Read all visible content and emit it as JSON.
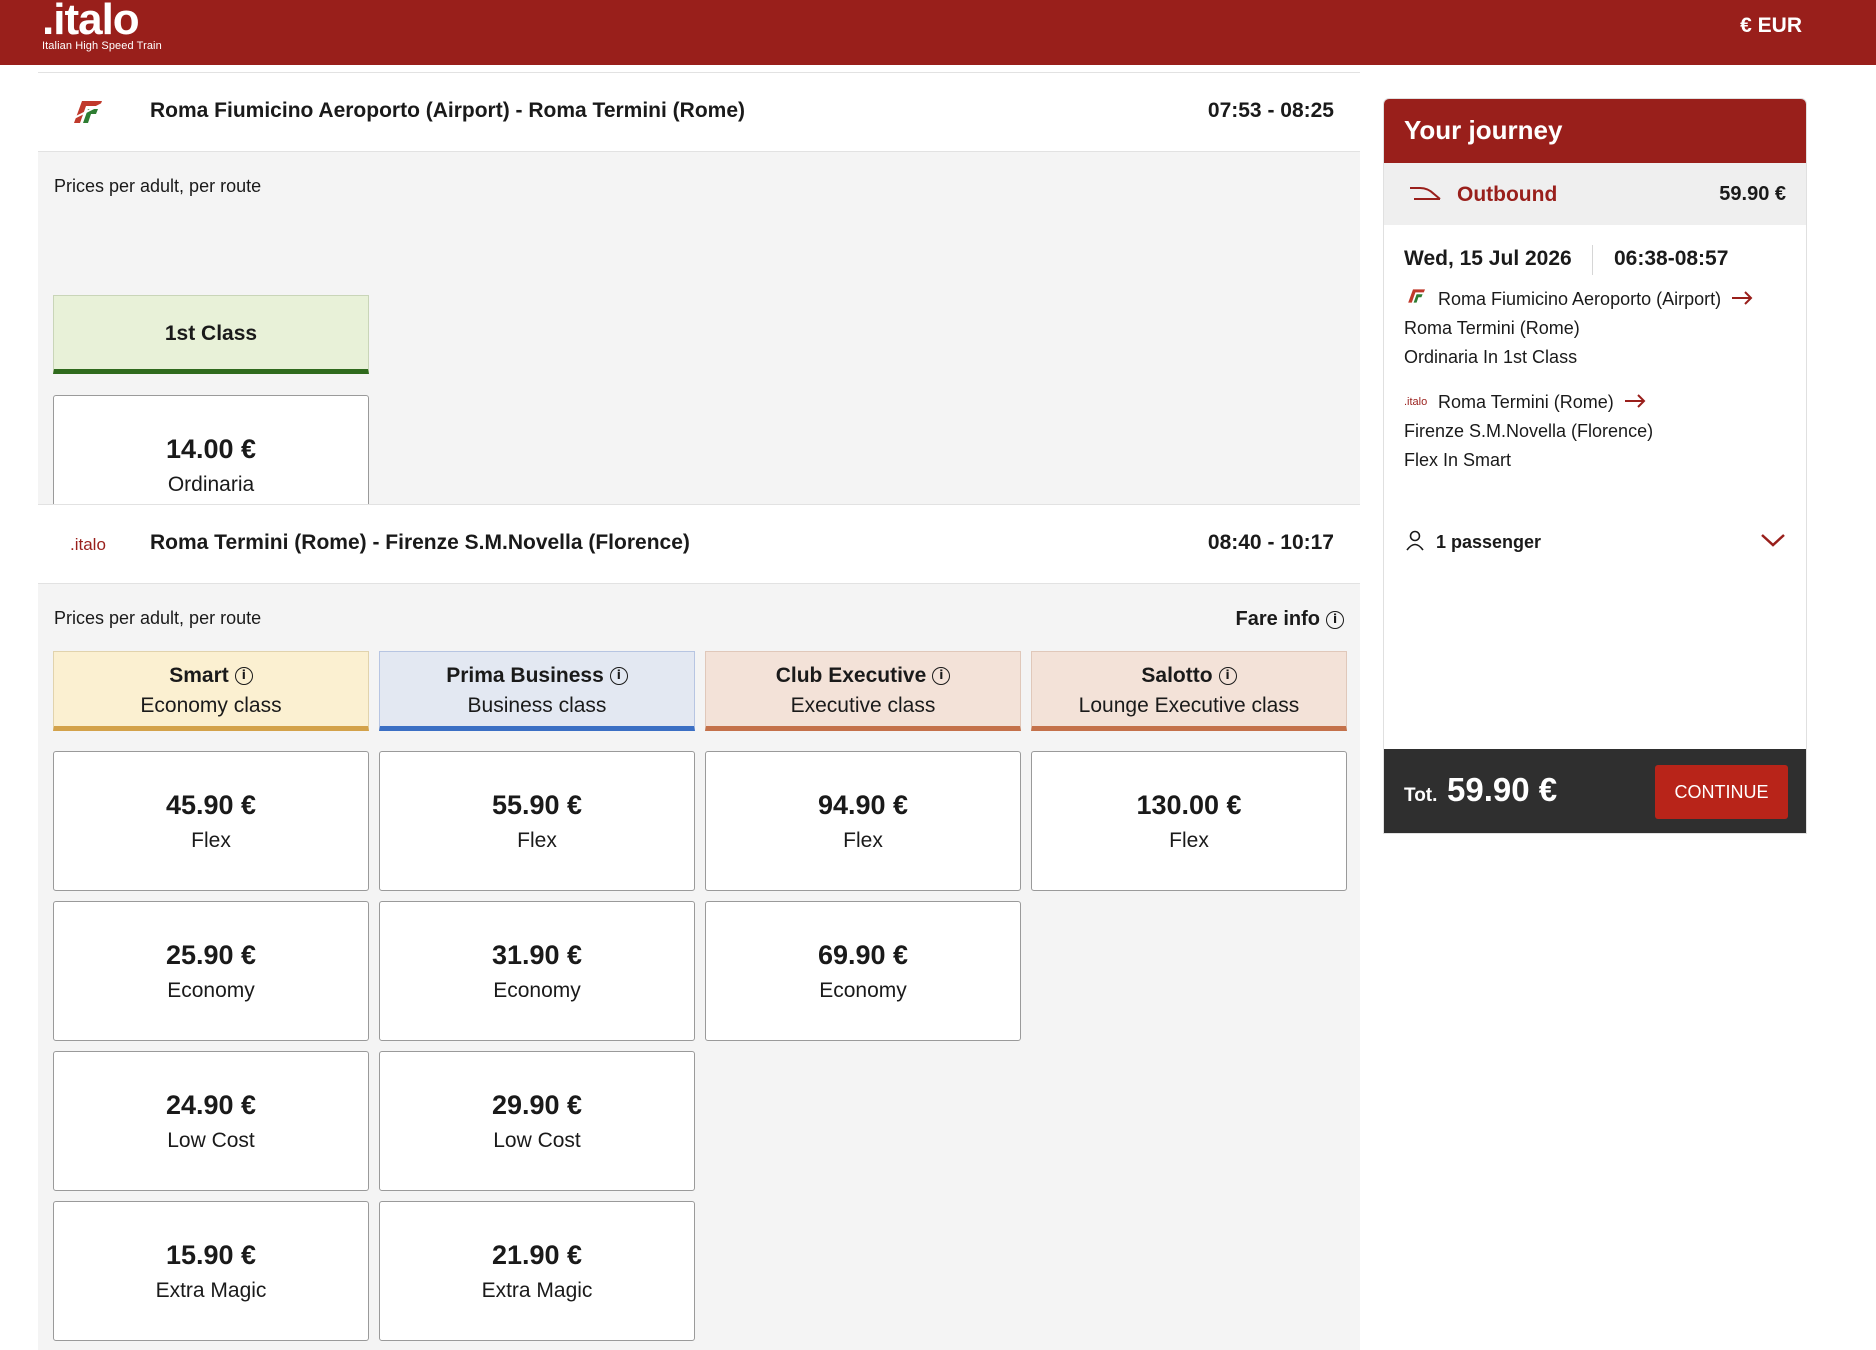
{
  "header": {
    "logo_word": ".italo",
    "logo_tagline": "Italian High Speed Train",
    "currency": "€ EUR"
  },
  "routes": [
    {
      "name": "Roma Fiumicino Aeroporto (Airport) - Roma Termini (Rome)",
      "time": "07:53 - 08:25",
      "prices_note": "Prices per adult, per route",
      "class_headers": [
        {
          "name": "1st Class",
          "color": "#e8f1d8",
          "border": "#2f6a1d"
        }
      ],
      "fares": [
        {
          "price": "14.00 €",
          "label": "Ordinaria"
        }
      ]
    },
    {
      "logo": ".italo",
      "name": "Roma Termini (Rome) - Firenze S.M.Novella (Florence)",
      "time": "08:40 - 10:17",
      "prices_note": "Prices per adult, per route",
      "fare_info": "Fare info",
      "class_headers": [
        {
          "name": "Smart",
          "sub": "Economy class",
          "color": "#fbf0d1",
          "border": "#d3a24a"
        },
        {
          "name": "Prima Business",
          "sub": "Business class",
          "color": "#e3e8f2",
          "border": "#3b6fc4"
        },
        {
          "name": "Club Executive",
          "sub": "Executive class",
          "color": "#f3e2d8",
          "border": "#c4714a"
        },
        {
          "name": "Salotto",
          "sub": "Lounge Executive class",
          "color": "#f3e2d8",
          "border": "#c4714a"
        }
      ],
      "fares": [
        [
          {
            "price": "45.90 €",
            "label": "Flex"
          },
          {
            "price": "25.90 €",
            "label": "Economy"
          },
          {
            "price": "24.90 €",
            "label": "Low Cost"
          },
          {
            "price": "15.90 €",
            "label": "Extra Magic"
          }
        ],
        [
          {
            "price": "55.90 €",
            "label": "Flex"
          },
          {
            "price": "31.90 €",
            "label": "Economy"
          },
          {
            "price": "29.90 €",
            "label": "Low Cost"
          },
          {
            "price": "21.90 €",
            "label": "Extra Magic"
          }
        ],
        [
          {
            "price": "94.90 €",
            "label": "Flex"
          },
          {
            "price": "69.90 €",
            "label": "Economy"
          }
        ],
        [
          {
            "price": "130.00 €",
            "label": "Flex"
          }
        ]
      ]
    }
  ],
  "journey": {
    "title": "Your journey",
    "outbound_label": "Outbound",
    "outbound_price": "59.90 €",
    "date": "Wed, 15 Jul 2026",
    "time": "06:38-08:57",
    "legs": [
      {
        "from": "Roma Fiumicino Aeroporto (Airport)",
        "to": "Roma Termini (Rome)",
        "fare": "Ordinaria In 1st Class"
      },
      {
        "logo": ".italo",
        "from": "Roma Termini (Rome)",
        "to": "Firenze S.M.Novella (Florence)",
        "fare": "Flex In Smart"
      }
    ],
    "passengers": "1 passenger",
    "total_label": "Tot.",
    "total_value": "59.90 €",
    "continue_label": "CONTINUE"
  },
  "colors": {
    "brand_red": "#991f1b",
    "button_red": "#b82419",
    "footer_dark": "#2f2f2f"
  }
}
